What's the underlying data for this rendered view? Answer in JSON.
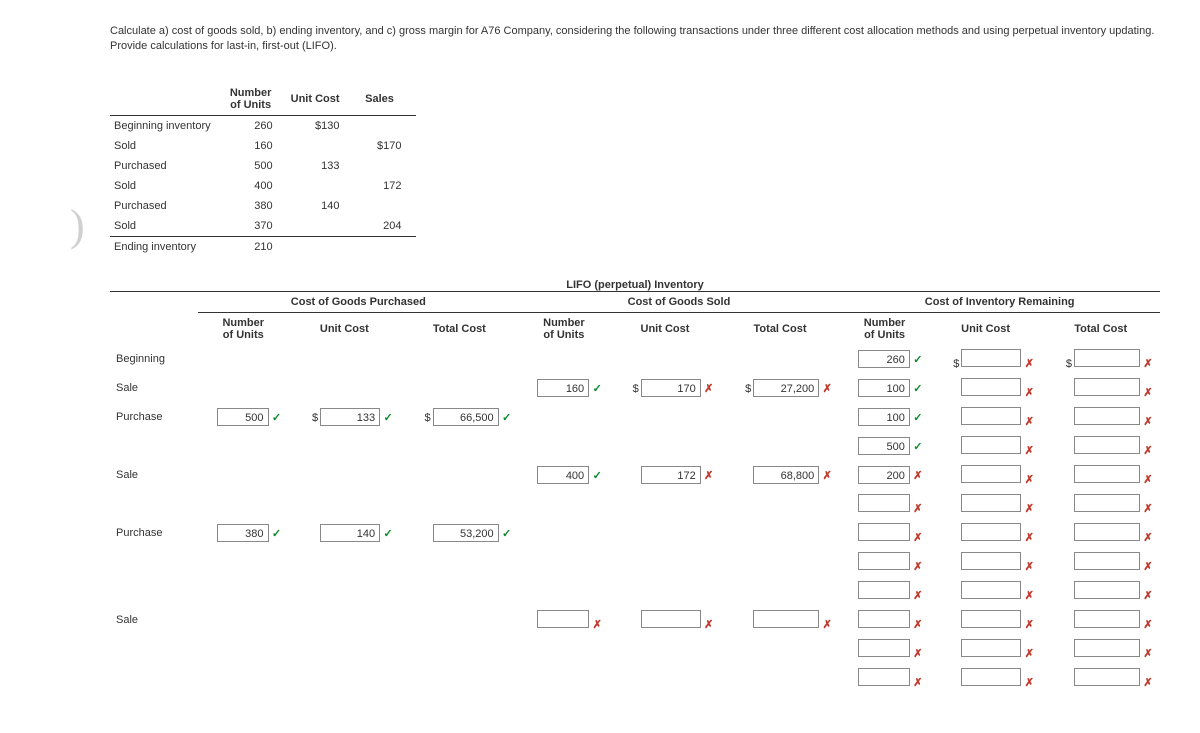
{
  "prompt": "Calculate a) cost of goods sold, b) ending inventory, and c) gross margin for A76 Company, considering the following transactions under three different cost allocation methods and using perpetual inventory updating. Provide calculations for last-in, first-out (LIFO).",
  "cols": {
    "units": "Number\nof Units",
    "unit_cost": "Unit Cost",
    "sales": "Sales"
  },
  "tx": [
    {
      "label": "Beginning inventory",
      "units": "260",
      "cost": "$130",
      "sales": ""
    },
    {
      "label": "Sold",
      "units": "160",
      "cost": "",
      "sales": "$170"
    },
    {
      "label": "Purchased",
      "units": "500",
      "cost": "133",
      "sales": ""
    },
    {
      "label": "Sold",
      "units": "400",
      "cost": "",
      "sales": "172"
    },
    {
      "label": "Purchased",
      "units": "380",
      "cost": "140",
      "sales": ""
    },
    {
      "label": "Sold",
      "units": "370",
      "cost": "",
      "sales": "204"
    },
    {
      "label": "Ending inventory",
      "units": "210",
      "cost": "",
      "sales": ""
    }
  ],
  "title": "LIFO (perpetual) Inventory",
  "sections": {
    "purch": "Cost of Goods Purchased",
    "sold": "Cost of Goods Sold",
    "inv": "Cost of Inventory Remaining"
  },
  "subcols": {
    "units": "Number\nof Units",
    "cost": "Unit Cost",
    "total": "Total Cost"
  },
  "rows": [
    {
      "lbl": "Beginning",
      "purch": {},
      "sold": {},
      "inv": [
        {
          "u": "260",
          "um": "ok",
          "c": "",
          "cm": "bad",
          "t": "",
          "tm": "bad",
          "cp": "$",
          "tp": "$"
        }
      ]
    },
    {
      "lbl": "Sale",
      "purch": {},
      "sold": {
        "u": "160",
        "um": "ok",
        "c": "170",
        "cm": "bad",
        "t": "27,200",
        "tm": "bad",
        "cp": "$",
        "tp": "$"
      },
      "inv": [
        {
          "u": "100",
          "um": "ok",
          "c": "",
          "cm": "bad",
          "t": "",
          "tm": "bad"
        }
      ]
    },
    {
      "lbl": "Purchase",
      "purch": {
        "u": "500",
        "um": "ok",
        "c": "133",
        "cm": "ok",
        "t": "66,500",
        "tm": "ok",
        "cp": "$",
        "tp": "$"
      },
      "sold": {},
      "inv": [
        {
          "u": "100",
          "um": "ok",
          "c": "",
          "cm": "bad",
          "t": "",
          "tm": "bad"
        },
        {
          "u": "500",
          "um": "ok",
          "c": "",
          "cm": "bad",
          "t": "",
          "tm": "bad"
        }
      ]
    },
    {
      "lbl": "Sale",
      "purch": {},
      "sold": {
        "u": "400",
        "um": "ok",
        "c": "172",
        "cm": "bad",
        "t": "68,800",
        "tm": "bad"
      },
      "inv": [
        {
          "u": "200",
          "um": "bad",
          "c": "",
          "cm": "bad",
          "t": "",
          "tm": "bad"
        },
        {
          "u": "",
          "um": "bad",
          "c": "",
          "cm": "bad",
          "t": "",
          "tm": "bad"
        }
      ]
    },
    {
      "lbl": "Purchase",
      "purch": {
        "u": "380",
        "um": "ok",
        "c": "140",
        "cm": "ok",
        "t": "53,200",
        "tm": "ok"
      },
      "sold": {},
      "inv": [
        {
          "u": "",
          "um": "bad",
          "c": "",
          "cm": "bad",
          "t": "",
          "tm": "bad"
        },
        {
          "u": "",
          "um": "bad",
          "c": "",
          "cm": "bad",
          "t": "",
          "tm": "bad"
        },
        {
          "u": "",
          "um": "bad",
          "c": "",
          "cm": "bad",
          "t": "",
          "tm": "bad"
        }
      ]
    },
    {
      "lbl": "Sale",
      "purch": {},
      "sold": {
        "u": "",
        "um": "bad",
        "c": "",
        "cm": "bad",
        "t": "",
        "tm": "bad"
      },
      "inv": [
        {
          "u": "",
          "um": "bad",
          "c": "",
          "cm": "bad",
          "t": "",
          "tm": "bad"
        },
        {
          "u": "",
          "um": "bad",
          "c": "",
          "cm": "bad",
          "t": "",
          "tm": "bad"
        },
        {
          "u": "",
          "um": "bad",
          "c": "",
          "cm": "bad",
          "t": "",
          "tm": "bad"
        }
      ]
    }
  ],
  "marks": {
    "ok": "✓",
    "bad": "✗"
  }
}
